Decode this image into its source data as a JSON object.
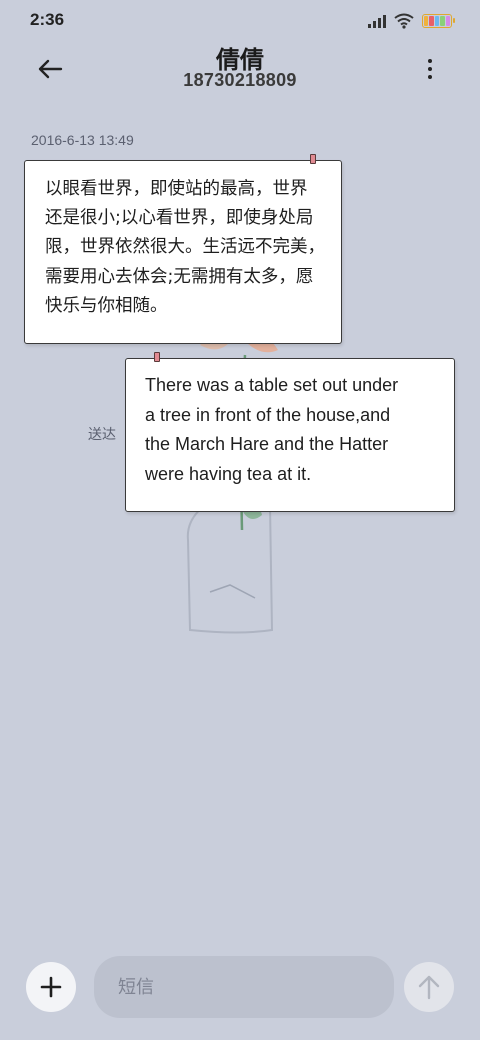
{
  "status_bar": {
    "time": "2:36",
    "battery_colors": [
      "#f0b23c",
      "#e8606a",
      "#6cb8f0",
      "#8ad07a",
      "#d58ae8"
    ]
  },
  "header": {
    "back_icon": "arrow-left-icon",
    "contact_name": "倩倩",
    "phone_number": "18730218809",
    "more_icon": "more-vertical-icon"
  },
  "conversation": {
    "timestamp": "2016-6-13 13:49",
    "messages": [
      {
        "lines": [
          "以眼看世界，即使站的最高，世界",
          "还是很小;以心看世界，即使身处局",
          "限，世界依然很大。生活远不完美，",
          "需要用心去体会;无需拥有太多，愿",
          "快乐与你相随。"
        ]
      },
      {
        "lines": [
          "There was a table set out under",
          "a tree in front of the house,and",
          "the March Hare and the Hatter",
          "were having tea at it."
        ],
        "status": "送达"
      }
    ]
  },
  "input_bar": {
    "add_icon": "plus-icon",
    "placeholder": "短信",
    "send_icon": "arrow-up-icon"
  },
  "colors": {
    "background": "#c9cedb",
    "bubble": "#ffffff",
    "input_field": "#bcc1ce"
  }
}
